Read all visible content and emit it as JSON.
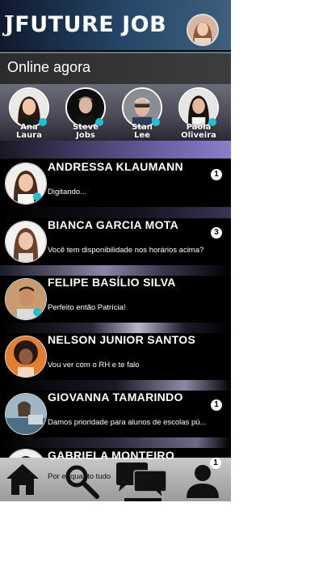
{
  "app": {
    "logo_mark": "J",
    "logo_text": "FUTURE JOB"
  },
  "online": {
    "title": "Online agora",
    "users": [
      {
        "line1": "Ana",
        "line2": "Laura"
      },
      {
        "line1": "Steve",
        "line2": "Jobs"
      },
      {
        "line1": "Stan",
        "line2": "Lee"
      },
      {
        "line1": "Paola",
        "line2": "Oliveira"
      }
    ]
  },
  "chats": [
    {
      "name": "ANDRESSA KLAUMANN",
      "message": "Digitando...",
      "badge": "1"
    },
    {
      "name": "BIANCA GARCIA MOTA",
      "message": "Você tem disponibilidade nos horários acima?",
      "badge": "3"
    },
    {
      "name": "FELIPE BASÍLIO SILVA",
      "message": "Perfeito então Patrícia!",
      "badge": ""
    },
    {
      "name": "NELSON JUNIOR SANTOS",
      "message": "Vou ver com o RH e te falo",
      "badge": ""
    },
    {
      "name": "GIOVANNA TAMARINDO",
      "message": "Damos prioridade para alunos de escolas pú...",
      "badge": "1"
    },
    {
      "name": "GABRIELA MONTEIRO",
      "message": "Por enquanto tudo",
      "badge": ""
    }
  ],
  "nav": {
    "items": [
      "home-icon",
      "search-icon",
      "chat-icon",
      "profile-icon"
    ],
    "profile_badge": "1"
  },
  "colors": {
    "online_dot": "#19c3cf",
    "header": "#27476a"
  }
}
